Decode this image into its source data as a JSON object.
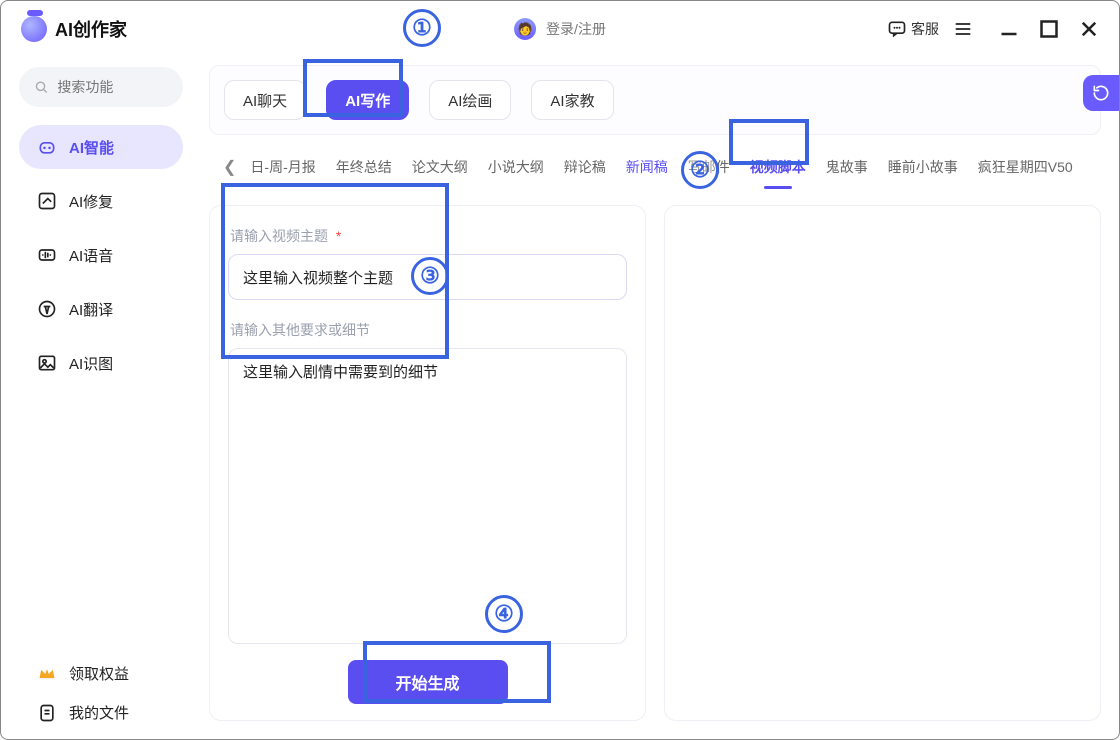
{
  "app": {
    "title": "AI创作家"
  },
  "header": {
    "login_text": "登录/注册",
    "service_label": "客服"
  },
  "search": {
    "placeholder": "搜索功能"
  },
  "sidebar": {
    "items": [
      {
        "label": "AI智能",
        "icon": "robot-icon",
        "active": true
      },
      {
        "label": "AI修复",
        "icon": "wand-icon"
      },
      {
        "label": "AI语音",
        "icon": "waveform-icon"
      },
      {
        "label": "AI翻译",
        "icon": "translate-icon"
      },
      {
        "label": "AI识图",
        "icon": "image-icon"
      }
    ],
    "bottom": {
      "benefits": "领取权益",
      "my_files": "我的文件"
    }
  },
  "tabs": {
    "items": [
      {
        "label": "AI聊天"
      },
      {
        "label": "AI写作",
        "active": true
      },
      {
        "label": "AI绘画"
      },
      {
        "label": "AI家教"
      }
    ]
  },
  "subtabs": {
    "prev_label": "日-周-月报",
    "items": [
      "年终总结",
      "论文大纲",
      "小说大纲",
      "辩论稿",
      "新闻稿",
      "写邮件",
      "视频脚本",
      "鬼故事",
      "睡前小故事",
      "疯狂星期四V50"
    ],
    "accent_index": 4,
    "active_index": 6
  },
  "form": {
    "topic_label": "请输入视频主题",
    "topic_value": "这里输入视频整个主题",
    "details_label": "请输入其他要求或细节",
    "details_value": "这里输入剧情中需要到的细节",
    "generate_label": "开始生成"
  },
  "callouts": {
    "one": "①",
    "two": "②",
    "three": "③",
    "four": "④"
  }
}
